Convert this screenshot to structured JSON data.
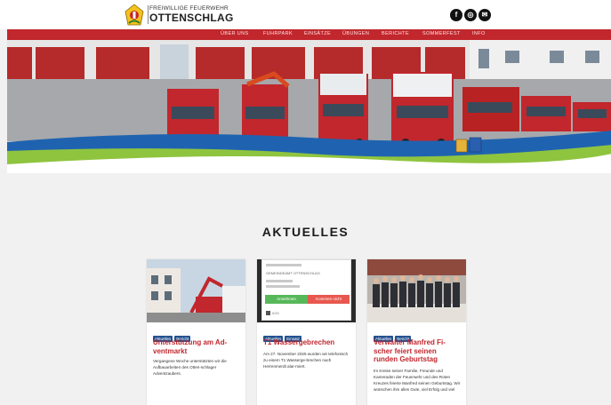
{
  "header": {
    "logo_small": "FREIWILLIGE FEUERWEHR",
    "logo_big": "OTTENSCHLAG",
    "social": [
      {
        "name": "facebook-icon",
        "glyph": "f"
      },
      {
        "name": "instagram-icon",
        "glyph": "◎"
      },
      {
        "name": "mail-icon",
        "glyph": "✉"
      }
    ]
  },
  "nav": {
    "items": [
      "ÜBER UNS",
      "FUHRPARK",
      "EINSÄTZE",
      "ÜBUNGEN",
      "BERICHTE",
      "SOMMERFEST",
      "INFO"
    ]
  },
  "main": {
    "section_title": "AKTUELLES"
  },
  "cards": [
    {
      "tags": [
        "Aktuelles",
        "Bericht"
      ],
      "title": "Unterstützung am Ad-ventmarkt",
      "text": "Vergangene Woche unterstützten wir die Aufbauarbeiten des Otten-schlager Adventzaubers."
    },
    {
      "tags": [
        "Aktuelles",
        "Einsatz"
      ],
      "title": "T1 Wassergebrechen",
      "text": "Am 27. November 2025 wurden wir telefonisch zu einem T1 Wasserge-brechen nach Herrenmerdt alar-miert.",
      "mini": {
        "heading": "GEMEINDEAMT OTTENSCHLAG",
        "btn_left": "Annehmen",
        "btn_right": "Kommen nicht",
        "footer": "0/20"
      }
    },
    {
      "tags": [
        "Aktuelles",
        "Bericht"
      ],
      "title": "Verwalter Manfred Fi-scher feiert seinen runden Geburtstag",
      "text": "Im Kreise seiner Familie, Freunde und Kameraden der Feuerwehr und des Roten Kreuzes feierte Manfred seinen Geburtstag. Wir wünschen ihm alles Gute, viel Erfolg und viel"
    }
  ],
  "colors": {
    "brand_red": "#c1272d",
    "tag_blue": "#24518f",
    "wave_blue": "#1f63b0",
    "wave_green": "#8fc43f"
  }
}
